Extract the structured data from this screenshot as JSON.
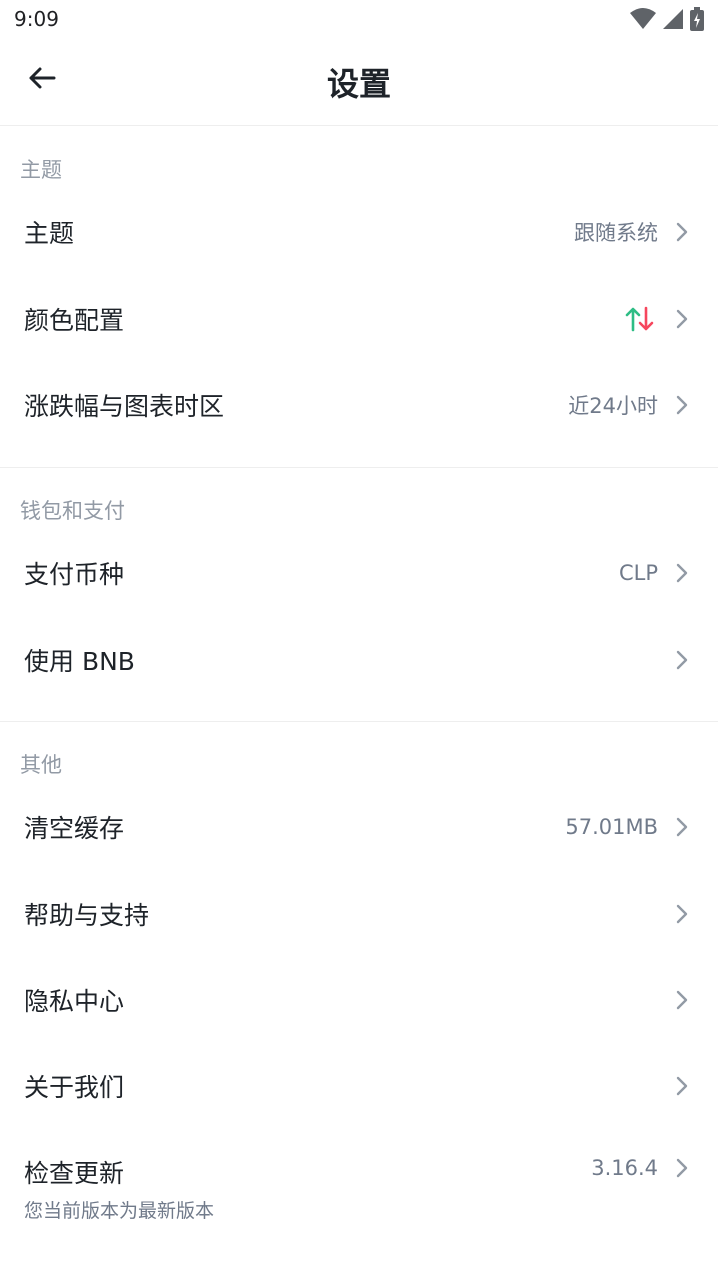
{
  "status_bar": {
    "time": "9:09"
  },
  "header": {
    "title": "设置"
  },
  "sections": {
    "theme": {
      "title": "主题",
      "theme_label": "主题",
      "theme_value": "跟随系统",
      "color_label": "颜色配置",
      "timezone_label": "涨跌幅与图表时区",
      "timezone_value": "近24小时"
    },
    "wallet": {
      "title": "钱包和支付",
      "currency_label": "支付币种",
      "currency_value": "CLP",
      "bnb_label": "使用 BNB"
    },
    "other": {
      "title": "其他",
      "cache_label": "清空缓存",
      "cache_value": "57.01MB",
      "help_label": "帮助与支持",
      "privacy_label": "隐私中心",
      "about_label": "关于我们",
      "update_label": "检查更新",
      "update_sub": "您当前版本为最新版本",
      "update_value": "3.16.4"
    }
  },
  "colors": {
    "up": "#2ebd85",
    "down": "#f6465d",
    "text_secondary": "#707a8a"
  },
  "icons": [
    "back-arrow-icon",
    "wifi-icon",
    "signal-icon",
    "battery-icon",
    "chevron-right-icon",
    "up-down-arrows-icon"
  ]
}
